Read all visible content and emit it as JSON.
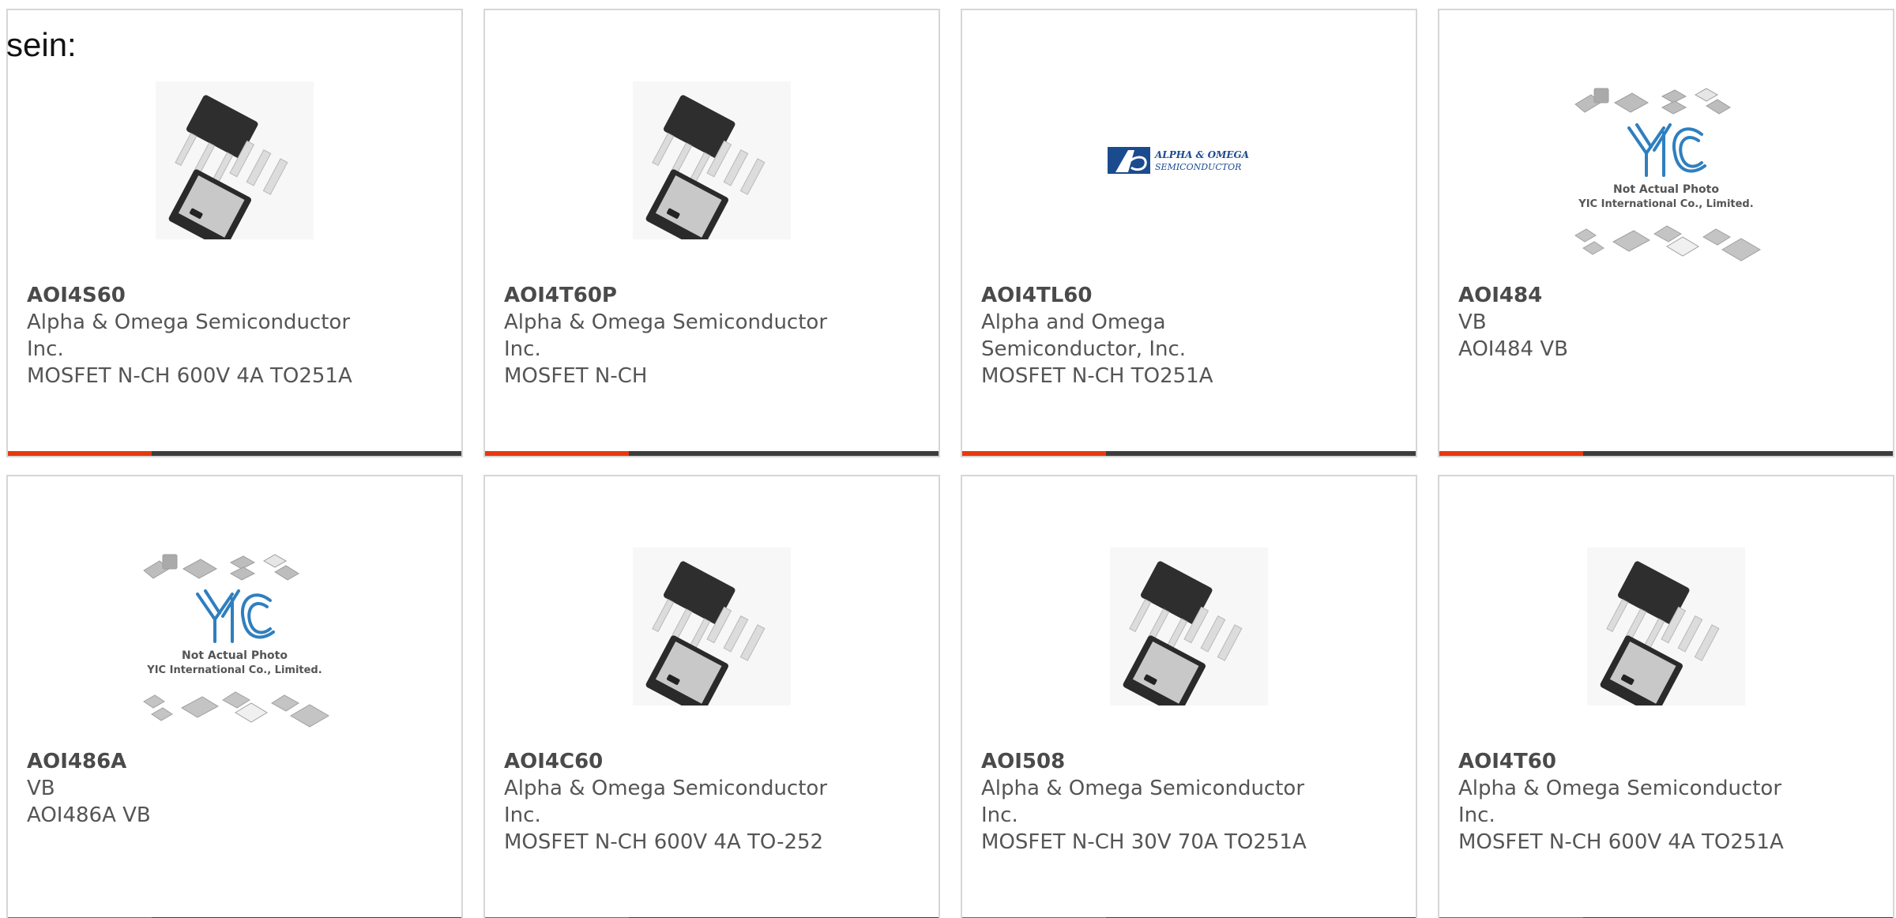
{
  "heading": "sein:",
  "colors": {
    "accent": "#e8390e",
    "bar": "#3d3d3d",
    "border": "#d6d6d6",
    "text": "#555555"
  },
  "products": [
    {
      "part": "AOI4S60",
      "manufacturer": "Alpha & Omega Semiconductor Inc.",
      "description": "MOSFET N-CH 600V 4A TO251A",
      "image": "to251-package-photo"
    },
    {
      "part": "AOI4T60P",
      "manufacturer": "Alpha & Omega Semiconductor Inc.",
      "description": "MOSFET N-CH",
      "image": "to251-package-photo"
    },
    {
      "part": "AOI4TL60",
      "manufacturer": "Alpha and Omega Semiconductor, Inc.",
      "description": "MOSFET N-CH TO251A",
      "image": "alpha-omega-logo",
      "logo_text_1": "ALPHA & OMEGA",
      "logo_text_2": "SEMICONDUCTOR"
    },
    {
      "part": "AOI484",
      "manufacturer": "VB",
      "description": "AOI484 VB",
      "image": "yic-placeholder",
      "photo_note_1": "Not Actual Photo",
      "photo_note_2": "YIC International Co., Limited."
    },
    {
      "part": "AOI486A",
      "manufacturer": "VB",
      "description": "AOI486A VB",
      "image": "yic-placeholder",
      "photo_note_1": "Not Actual Photo",
      "photo_note_2": "YIC International Co., Limited."
    },
    {
      "part": "AOI4C60",
      "manufacturer": "Alpha & Omega Semiconductor Inc.",
      "description": "MOSFET N-CH 600V 4A TO-252",
      "image": "to251-package-photo"
    },
    {
      "part": "AOI508",
      "manufacturer": "Alpha & Omega Semiconductor Inc.",
      "description": "MOSFET N-CH 30V 70A TO251A",
      "image": "to251-package-photo"
    },
    {
      "part": "AOI4T60",
      "manufacturer": "Alpha & Omega Semiconductor Inc.",
      "description": "MOSFET N-CH 600V 4A TO251A",
      "image": "to251-package-photo"
    }
  ]
}
